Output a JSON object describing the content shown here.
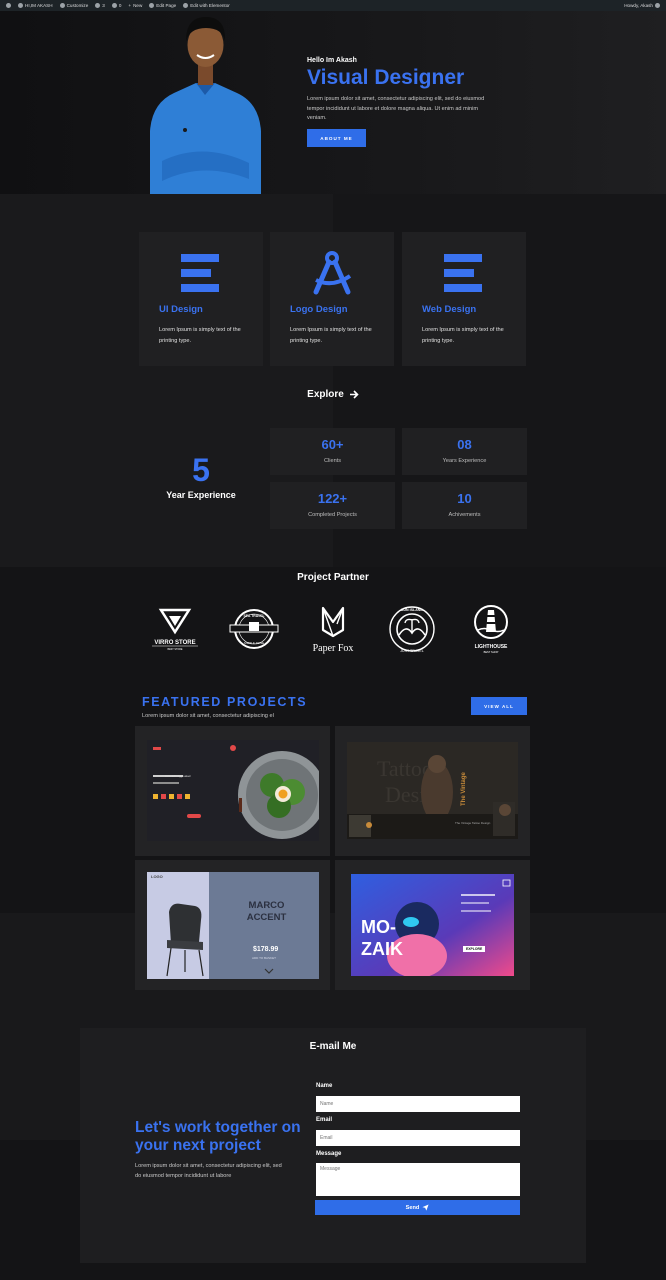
{
  "admin_bar": {
    "site_name": "HI,IM AKASH",
    "customize": "Customize",
    "comments": "3",
    "updates": "0",
    "new": "New",
    "edit_page": "Edit Page",
    "edit_elementor": "Edit with Elementor",
    "howdy": "Howdy, Akash"
  },
  "hero": {
    "greeting": "Hello Im Akash",
    "title": "Visual Designer",
    "text": "Lorem ipsum dolor sit amet, consectetur adipiscing elit, sed do eiusmod tempor incididunt ut labore et dolore magna aliqua. Ut enim ad minim veniam.",
    "button": "ABOUT ME"
  },
  "services": [
    {
      "title": "UI Design",
      "desc": "Lorem Ipsum is simply text of the printing type.",
      "icon": "menu-bars-icon"
    },
    {
      "title": "Logo Design",
      "desc": "Lorem Ipsum is simply text of the printing type.",
      "icon": "compass-icon"
    },
    {
      "title": "Web Design",
      "desc": "Lorem Ipsum is simply text of the printing type.",
      "icon": "menu-bars-icon"
    }
  ],
  "explore": {
    "label": "Explore",
    "icon": "arrow-right-icon"
  },
  "experience": {
    "number": "5",
    "label": "Year Experience"
  },
  "stats": [
    {
      "value": "60+",
      "label": "Clients"
    },
    {
      "value": "08",
      "label": "Years Experience"
    },
    {
      "value": "122+",
      "label": "Completed Projects"
    },
    {
      "value": "10",
      "label": "Achivements"
    }
  ],
  "partners": {
    "heading": "Project Partner",
    "logos": [
      {
        "name": "VIRRO STORE",
        "sub": "BEST STORE"
      },
      {
        "name": "SEA TRAVEL",
        "sub": "SIMPLE ZONE"
      },
      {
        "name": "Paper Fox",
        "sub": ""
      },
      {
        "name": "SUN ISLAND",
        "sub": "JUST TRAVEL"
      },
      {
        "name": "LIGHTHOUSE",
        "sub": "BEST SHOP"
      }
    ]
  },
  "featured": {
    "title": "FEATURED PROJECTS",
    "subtitle": "Lorem ipsum dolor sit amet, consectetur adipiscing el",
    "button": "VIEW ALL",
    "projects": [
      {
        "label": "Avocado egg salad"
      },
      {
        "label": "The Vintage Tattoo Design"
      },
      {
        "logo": "LOGO",
        "title": "MARCO ACCENT",
        "price": "$178.99",
        "cta": "ADD TO BASKET"
      },
      {
        "title": "MO-ZAIK",
        "cta": "EXPLORE"
      }
    ]
  },
  "contact": {
    "heading": "E-mail Me",
    "headline": "Let's work together on your next project",
    "text": "Lorem ipsum dolor sit amet, consectetur adipiscing elit, sed do eiusmod tempor incididunt ut labore",
    "name_label": "Name",
    "name_placeholder": "Name",
    "email_label": "Email",
    "email_placeholder": "Email",
    "message_label": "Message",
    "message_placeholder": "Message",
    "send": "Send",
    "send_icon": "paper-plane-icon"
  },
  "colors": {
    "accent": "#3a72f0",
    "background": "#141416",
    "card": "#202022"
  }
}
